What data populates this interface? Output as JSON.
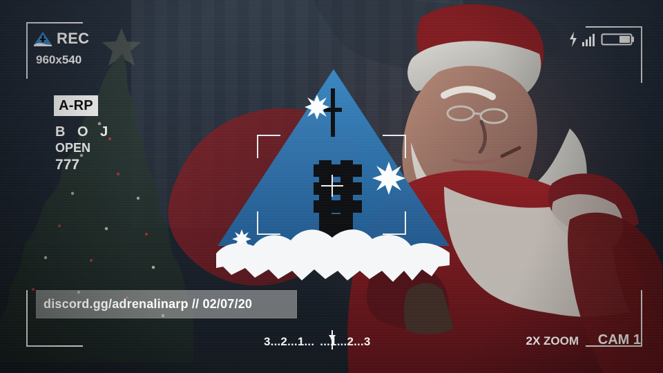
{
  "hud": {
    "rec_label": "REC",
    "resolution": "960x540",
    "server_badge": "A-RP",
    "line_boj": "B O J",
    "line_open": "OPEN",
    "line_number": "777",
    "discord_text": "discord.gg/adrenalinarp // 02/07/20",
    "timeline_text": "3...2...1...",
    "timeline_text_right": "...1...2...3",
    "zoom_text": "2X ZOOM",
    "camera_text": "CAM 1"
  },
  "icons": {
    "rec_logo": "triangle-logo-icon",
    "flash": "flash-icon",
    "signal": "signal-icon",
    "battery": "battery-icon",
    "snowflake": "snowflake-icon"
  },
  "colors": {
    "hud_white": "#f3f3f3",
    "logo_blue": "#2c78b8",
    "santa_red": "#7e1d21",
    "bg_dark": "#1d2530"
  }
}
